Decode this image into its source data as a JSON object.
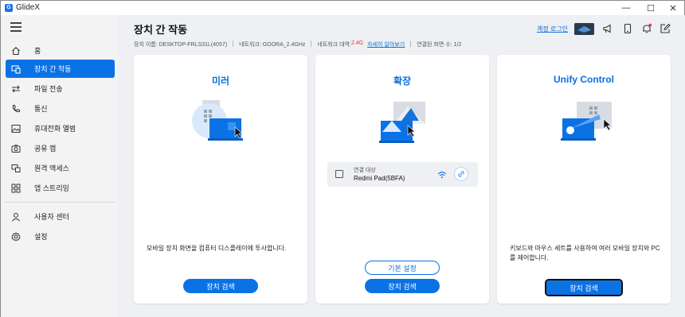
{
  "app": {
    "title": "GlideX",
    "logo_letter": "G"
  },
  "window_controls": {
    "minimize": "—",
    "maximize": "☐",
    "close": "✕"
  },
  "sidebar": {
    "items": [
      {
        "label": "홈",
        "icon": "home-icon"
      },
      {
        "label": "장치 간 작동",
        "icon": "cross-device-icon",
        "active": true
      },
      {
        "label": "파일 전송",
        "icon": "transfer-icon"
      },
      {
        "label": "통신",
        "icon": "phone-icon"
      },
      {
        "label": "휴대전화 앨범",
        "icon": "album-icon"
      },
      {
        "label": "공유 캠",
        "icon": "camera-icon"
      },
      {
        "label": "원격 액세스",
        "icon": "remote-access-icon"
      },
      {
        "label": "앱 스트리밍",
        "icon": "app-streaming-icon"
      },
      {
        "label": "사용자 센터",
        "icon": "user-icon"
      },
      {
        "label": "설정",
        "icon": "gear-icon"
      }
    ]
  },
  "header": {
    "title": "장치 간 작동",
    "device_name": "장치 이름: DESKTOP-FRLS31L(4057)",
    "network": "네트워크: GOORA_2.4GHz",
    "band_label": "네트워크 대역: ",
    "band_value": "2.4G",
    "learn_more": "자세히 알아보기",
    "connected_devices": "연결된 화면 수: 1/2",
    "login_link": "계정 로그인"
  },
  "cards": {
    "mirror": {
      "title": "미러",
      "description": "모바일 장치 화면을 컴퓨터 디스플레이에 투사합니다.",
      "button": "장치 검색"
    },
    "extend": {
      "title": "확장",
      "device_label": "연결 대상",
      "device_name": "Redmi Pad(5BFA)",
      "settings_button": "기본 설정",
      "button": "장치 검색"
    },
    "unify": {
      "title": "Unify Control",
      "description": "키보드와 마우스 세트를 사용하여 여러 모바일 장치와 PC를 제어합니다.",
      "button": "장치 검색"
    }
  },
  "colors": {
    "accent": "#0b72e6",
    "warning": "#e33333",
    "sidebar_bg": "#f3f3f3",
    "main_bg": "#eef0f3"
  }
}
